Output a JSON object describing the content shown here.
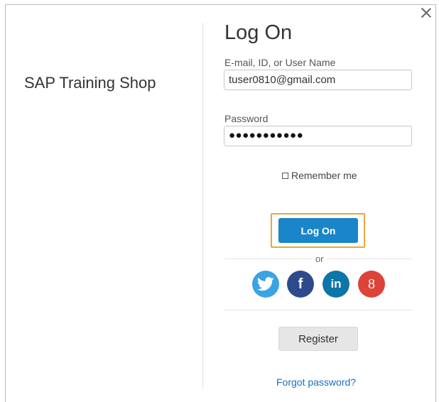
{
  "brand": {
    "title": "SAP Training Shop"
  },
  "dialog": {
    "title": "Log On"
  },
  "form": {
    "username_label": "E-mail, ID, or User Name",
    "username_value": "tuser0810@gmail.com",
    "password_label": "Password",
    "password_mask": "●●●●●●●●●●●",
    "remember_label": "Remember me",
    "remember_checked": false,
    "logon_label": "Log On"
  },
  "divider": {
    "or_text": "or"
  },
  "social": [
    {
      "name": "twitter",
      "icon": "twitter-bird-icon",
      "color": "#3aa3e3"
    },
    {
      "name": "facebook",
      "icon": "facebook-f-icon",
      "glyph": "f",
      "color": "#2d4b8b"
    },
    {
      "name": "linkedin",
      "icon": "linkedin-in-icon",
      "glyph": "in",
      "color": "#0d76a9"
    },
    {
      "name": "google",
      "icon": "google-plus-8-icon",
      "glyph": "8",
      "color": "#dc4437"
    }
  ],
  "actions": {
    "register_label": "Register",
    "forgot_label": "Forgot password?"
  },
  "colors": {
    "primary": "#1a85c8",
    "highlight": "#e8a83a",
    "link": "#1a6fbf"
  }
}
